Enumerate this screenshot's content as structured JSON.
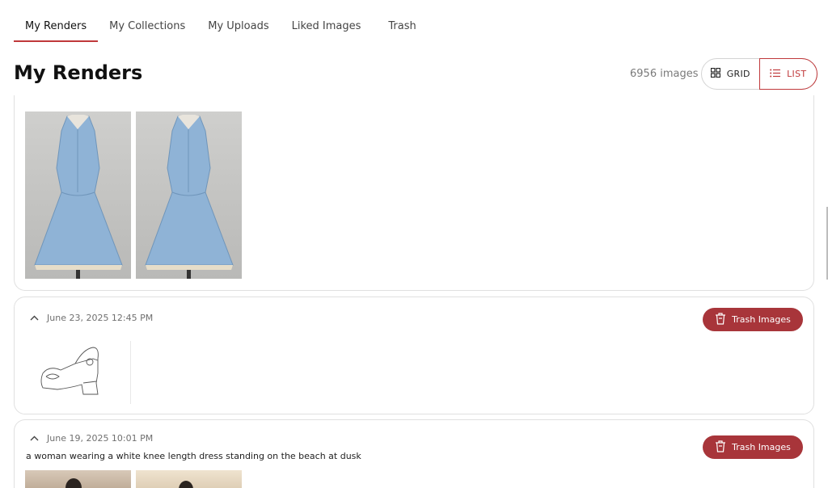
{
  "tabs": [
    {
      "label": "My Renders",
      "active": true
    },
    {
      "label": "My Collections",
      "active": false
    },
    {
      "label": "My Uploads",
      "active": false
    },
    {
      "label": "Liked Images",
      "active": false
    },
    {
      "label": "Trash",
      "active": false
    }
  ],
  "page": {
    "title": "My Renders",
    "count": "6956 images"
  },
  "view_toggle": {
    "grid_label": "GRID",
    "list_label": "LIST",
    "grid_icon": "grid-icon",
    "list_icon": "list-icon"
  },
  "renders": [
    {
      "date": "",
      "prompt": "",
      "images": [
        "blue-dress-render-1",
        "blue-dress-render-2"
      ]
    },
    {
      "date": "June 23, 2025 12:45 PM",
      "prompt": "",
      "trash_label": "Trash Images",
      "images": [
        "shoe-sketch"
      ]
    },
    {
      "date": "June 19, 2025 10:01 PM",
      "prompt": "a woman wearing a white knee length dress standing on the beach at dusk",
      "trash_label": "Trash Images",
      "images": [
        "beach-render-1",
        "beach-render-2"
      ]
    }
  ],
  "colors": {
    "accent": "#c0393b",
    "trash_button": "#a8353a",
    "dress": "#8fb3d6"
  }
}
